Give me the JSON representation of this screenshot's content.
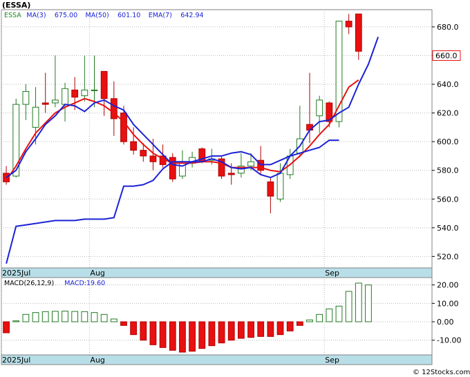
{
  "header": {
    "ticker_title": "(ESSA)"
  },
  "footer": {
    "copyright": "© 12Stocks.com"
  },
  "colors": {
    "up_fill": "#ffffff",
    "up_stroke": "#217a21",
    "down_fill": "#e81010",
    "down_stroke": "#b00000",
    "ma_blue": "#1a22d6",
    "ema_red": "#e81010",
    "grid": "#b8b8b8",
    "date_bar": "#b8dfe8",
    "price_tag_stroke": "#e81010"
  },
  "chart_data": [
    {
      "type": "candlestick",
      "panel": "price",
      "legend": [
        {
          "text": "ESSA",
          "color": "#1f8a1f"
        },
        {
          "text": "MA(3)",
          "color": "#1a22d6"
        },
        {
          "text": "675.00",
          "color": "#1a22d6"
        },
        {
          "text": "MA(50)",
          "color": "#1a22d6"
        },
        {
          "text": "601.10",
          "color": "#1a22d6"
        },
        {
          "text": "EMA(7)",
          "color": "#1a22d6"
        },
        {
          "text": "642.94",
          "color": "#1a22d6"
        }
      ],
      "last_price_label": "660.0",
      "last_price": 660.0,
      "ylim": [
        512,
        692
      ],
      "yticks": [
        520,
        540,
        560,
        580,
        600,
        620,
        640,
        660,
        680
      ],
      "ytick_labels": [
        "520.0",
        "540.0",
        "560.0",
        "580.0",
        "600.0",
        "620.0",
        "640.0",
        "660.0",
        "680.0"
      ],
      "x_labels": [
        {
          "label": "2025Jul",
          "index": 0
        },
        {
          "label": "Aug",
          "index": 9
        },
        {
          "label": "Sep",
          "index": 33
        }
      ],
      "n_slots": 44,
      "candles": [
        {
          "o": 578,
          "h": 583,
          "l": 570,
          "c": 572
        },
        {
          "o": 576,
          "h": 630,
          "l": 575,
          "c": 626
        },
        {
          "o": 626,
          "h": 640,
          "l": 615,
          "c": 635
        },
        {
          "o": 610,
          "h": 638,
          "l": 598,
          "c": 624
        },
        {
          "o": 627,
          "h": 648,
          "l": 620,
          "c": 626
        },
        {
          "o": 627,
          "h": 660,
          "l": 624,
          "c": 629
        },
        {
          "o": 626,
          "h": 641,
          "l": 614,
          "c": 637
        },
        {
          "o": 636,
          "h": 645,
          "l": 622,
          "c": 631
        },
        {
          "o": 632,
          "h": 660,
          "l": 628,
          "c": 636
        },
        {
          "o": 636,
          "h": 660,
          "l": 624,
          "c": 636
        },
        {
          "o": 649,
          "h": 649,
          "l": 618,
          "c": 630
        },
        {
          "o": 630,
          "h": 642,
          "l": 604,
          "c": 616
        },
        {
          "o": 620,
          "h": 625,
          "l": 598,
          "c": 600
        },
        {
          "o": 600,
          "h": 610,
          "l": 591,
          "c": 594
        },
        {
          "o": 594,
          "h": 599,
          "l": 586,
          "c": 590
        },
        {
          "o": 590,
          "h": 602,
          "l": 580,
          "c": 586
        },
        {
          "o": 590,
          "h": 598,
          "l": 582,
          "c": 584
        },
        {
          "o": 589,
          "h": 592,
          "l": 572,
          "c": 574
        },
        {
          "o": 576,
          "h": 594,
          "l": 574,
          "c": 585
        },
        {
          "o": 585,
          "h": 593,
          "l": 582,
          "c": 589
        },
        {
          "o": 595,
          "h": 596,
          "l": 585,
          "c": 586
        },
        {
          "o": 587,
          "h": 595,
          "l": 584,
          "c": 588
        },
        {
          "o": 588,
          "h": 590,
          "l": 574,
          "c": 576
        },
        {
          "o": 578,
          "h": 585,
          "l": 570,
          "c": 577
        },
        {
          "o": 578,
          "h": 592,
          "l": 575,
          "c": 583
        },
        {
          "o": 583,
          "h": 592,
          "l": 580,
          "c": 586
        },
        {
          "o": 587,
          "h": 597,
          "l": 577,
          "c": 580
        },
        {
          "o": 572,
          "h": 575,
          "l": 550,
          "c": 562
        },
        {
          "o": 560,
          "h": 585,
          "l": 558,
          "c": 578
        },
        {
          "o": 577,
          "h": 595,
          "l": 574,
          "c": 590
        },
        {
          "o": 592,
          "h": 625,
          "l": 589,
          "c": 602
        },
        {
          "o": 612,
          "h": 648,
          "l": 599,
          "c": 608
        },
        {
          "o": 618,
          "h": 632,
          "l": 606,
          "c": 629
        },
        {
          "o": 627,
          "h": 628,
          "l": 610,
          "c": 614
        },
        {
          "o": 614,
          "h": 684,
          "l": 610,
          "c": 684
        },
        {
          "o": 684,
          "h": 689,
          "l": 675,
          "c": 680
        },
        {
          "o": 689,
          "h": 689,
          "l": 657,
          "c": 663
        }
      ],
      "ma3": [
        575,
        580,
        593,
        602,
        612,
        618,
        626,
        625,
        621,
        627,
        629,
        625,
        622,
        612,
        605,
        598,
        591,
        584,
        583,
        586,
        586,
        588,
        586,
        582,
        581,
        582,
        577,
        575,
        578,
        590,
        597,
        608,
        614,
        615,
        620,
        624,
        640,
        654,
        673
      ],
      "ma50": [
        515,
        541,
        542,
        543,
        544,
        545,
        545,
        545,
        546,
        546,
        546,
        547,
        569,
        569,
        570,
        573,
        581,
        586,
        586,
        586,
        588,
        590,
        590,
        592,
        593,
        591,
        584,
        584,
        587,
        590,
        592,
        594,
        596,
        601,
        601
      ],
      "ema7": [
        573,
        583,
        595,
        606,
        613,
        620,
        624,
        627,
        630,
        628,
        625,
        620,
        614,
        605,
        598,
        592,
        588,
        585,
        585,
        585,
        586,
        586,
        585,
        582,
        582,
        582,
        582,
        580,
        579,
        584,
        590,
        597,
        605,
        612,
        625,
        638,
        643
      ]
    },
    {
      "type": "bar",
      "panel": "macd",
      "legend": [
        {
          "text": "MACD(26,12,9)",
          "color": "#000000"
        },
        {
          "text": "MACD:19.60",
          "color": "#1a22d6"
        }
      ],
      "ylim": [
        -18,
        24
      ],
      "yticks": [
        -10,
        0,
        10,
        20
      ],
      "ytick_labels": [
        "-10.00",
        "0.00",
        "10.00",
        "20.00"
      ],
      "x_labels": [
        {
          "label": "2025Jul",
          "index": 0
        },
        {
          "label": "Aug",
          "index": 9
        },
        {
          "label": "Sep",
          "index": 33
        }
      ],
      "values": [
        -6,
        0.5,
        4,
        5,
        5.5,
        5.7,
        5.8,
        5.6,
        5.5,
        5,
        4,
        1.5,
        -2,
        -7,
        -10,
        -12.5,
        -14,
        -15.5,
        -16.5,
        -16,
        -14.5,
        -13,
        -11.5,
        -10,
        -9,
        -8.5,
        -8,
        -8,
        -7,
        -5,
        -2,
        1,
        4,
        7,
        8.5,
        16.5,
        21,
        20
      ]
    }
  ]
}
